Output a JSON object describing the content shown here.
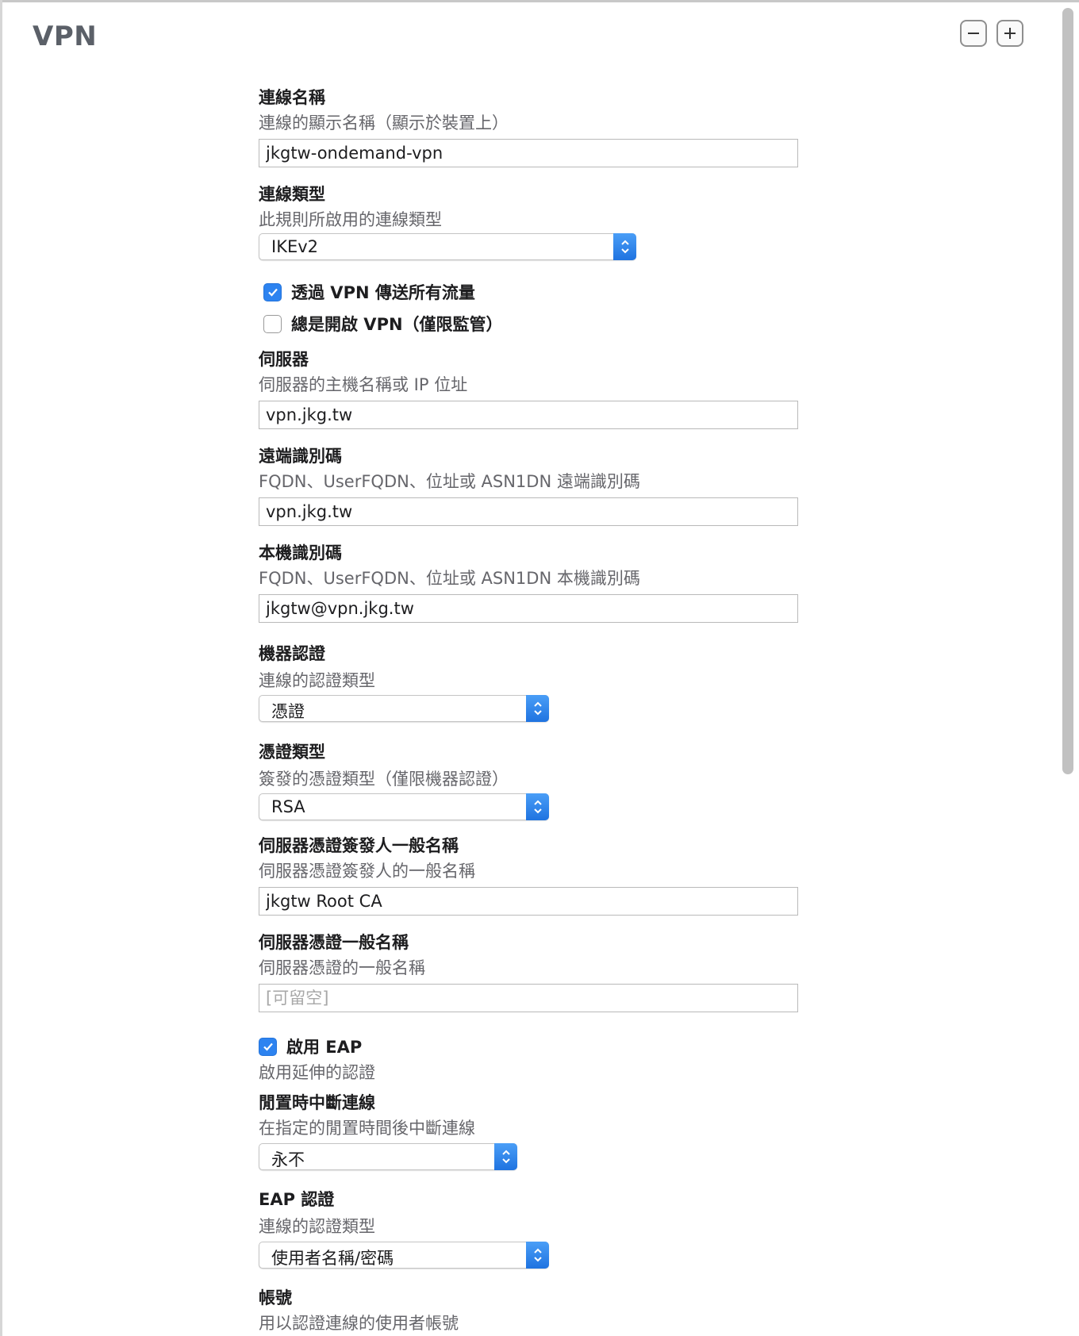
{
  "pane": {
    "title": "VPN",
    "remove_icon": "minus-icon",
    "add_icon": "plus-icon"
  },
  "colors": {
    "accent": "#2d83f0",
    "title_gray": "#5b6068",
    "desc_gray": "#66666b"
  },
  "fields": {
    "connection_name": {
      "title": "連線名稱",
      "desc": "連線的顯示名稱（顯示於裝置上）",
      "value": "jkgtw-ondemand-vpn"
    },
    "connection_type": {
      "title": "連線類型",
      "desc": "此規則所啟用的連線類型",
      "value": "IKEv2"
    },
    "send_all_traffic": {
      "label": "透過 VPN 傳送所有流量",
      "checked": true
    },
    "always_on": {
      "label": "總是開啟 VPN（僅限監管）",
      "checked": false
    },
    "server": {
      "title": "伺服器",
      "desc": "伺服器的主機名稱或 IP 位址",
      "value": "vpn.jkg.tw"
    },
    "remote_id": {
      "title": "遠端識別碼",
      "desc": "FQDN、UserFQDN、位址或 ASN1DN 遠端識別碼",
      "value": "vpn.jkg.tw"
    },
    "local_id": {
      "title": "本機識別碼",
      "desc": "FQDN、UserFQDN、位址或 ASN1DN 本機識別碼",
      "value": "jkgtw@vpn.jkg.tw"
    },
    "machine_auth": {
      "title": "機器認證",
      "desc": "連線的認證類型",
      "value": "憑證"
    },
    "cert_type": {
      "title": "憑證類型",
      "desc": "簽發的憑證類型（僅限機器認證）",
      "value": "RSA"
    },
    "server_cert_issuer_cn": {
      "title": "伺服器憑證簽發人一般名稱",
      "desc": "伺服器憑證簽發人的一般名稱",
      "value": "jkgtw Root CA"
    },
    "server_cert_cn": {
      "title": "伺服器憑證一般名稱",
      "desc": "伺服器憑證的一般名稱",
      "value": "",
      "placeholder": "[可留空]"
    },
    "enable_eap": {
      "label": "啟用 EAP",
      "desc": "啟用延伸的認證",
      "checked": true
    },
    "idle_disconnect": {
      "title": "閒置時中斷連線",
      "desc": "在指定的閒置時間後中斷連線",
      "value": "永不"
    },
    "eap_auth": {
      "title": "EAP 認證",
      "desc": "連線的認證類型",
      "value": "使用者名稱/密碼"
    },
    "account": {
      "title": "帳號",
      "desc": "用以認證連線的使用者帳號"
    }
  }
}
